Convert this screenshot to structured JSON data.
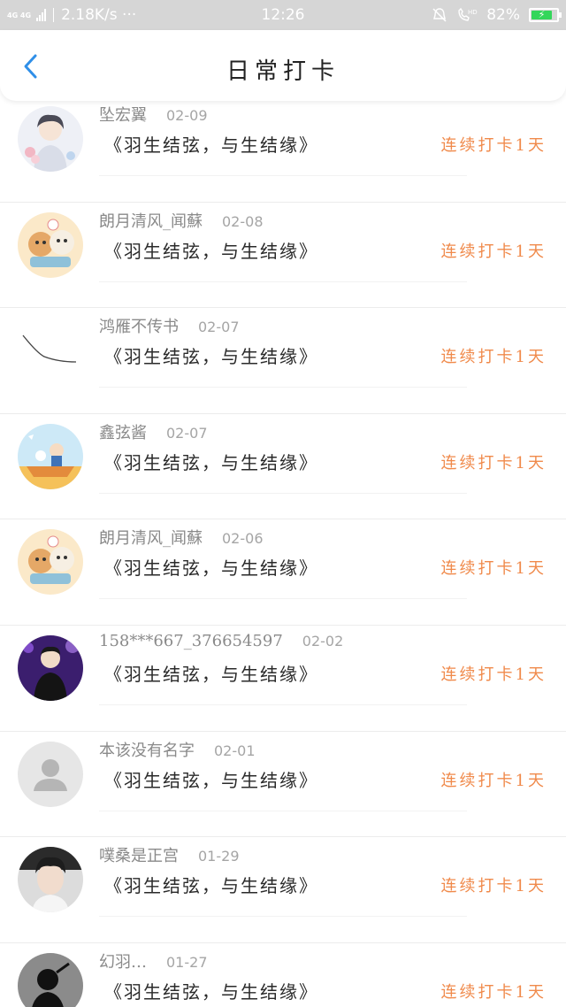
{
  "status_bar": {
    "network": "4G 4G",
    "speed": "2.18K/s ···",
    "time": "12:26",
    "battery": "82%",
    "battery_level": 0.82,
    "accent": "#33d65a"
  },
  "header": {
    "title": "日常打卡",
    "back_icon": "chevron-left-icon",
    "back_color": "#2f8fe8"
  },
  "entries": [
    {
      "name": "坠宏翼",
      "date": "02-09",
      "quote": "《羽生结弦，与生结缘》",
      "streak": "连续打卡1天",
      "avatar": "anime-boy-flowers"
    },
    {
      "name": "朗月清风_闻蘇",
      "date": "02-08",
      "quote": "《羽生结弦，与生结缘》",
      "streak": "连续打卡1天",
      "avatar": "cartoon-dog-sticker"
    },
    {
      "name": "鸿雁不传书",
      "date": "02-07",
      "quote": "《羽生结弦，与生结缘》",
      "streak": "连续打卡1天",
      "avatar": "line-sketch"
    },
    {
      "name": "鑫弦酱",
      "date": "02-07",
      "quote": "《羽生结弦，与生结缘》",
      "streak": "连续打卡1天",
      "avatar": "cartoon-boat"
    },
    {
      "name": "朗月清风_闻蘇",
      "date": "02-06",
      "quote": "《羽生结弦，与生结缘》",
      "streak": "连续打卡1天",
      "avatar": "cartoon-dog-sticker"
    },
    {
      "name": "158***667_376654597",
      "date": "02-02",
      "quote": "《羽生结弦，与生结缘》",
      "streak": "连续打卡1天",
      "avatar": "performer-purple"
    },
    {
      "name": "本该没有名字",
      "date": "02-01",
      "quote": "《羽生结弦，与生结缘》",
      "streak": "连续打卡1天",
      "avatar": "default-user-icon"
    },
    {
      "name": "噗桑是正宫",
      "date": "01-29",
      "quote": "《羽生结弦，与生结缘》",
      "streak": "连续打卡1天",
      "avatar": "portrait-photo"
    },
    {
      "name": "幻羽…",
      "date": "01-27",
      "quote": "《羽生结弦，与生结缘》",
      "streak": "连续打卡1天",
      "avatar": "silhouette"
    }
  ],
  "colors": {
    "streak": "#f08a4b",
    "name": "#8a8a8a",
    "quote": "#2a2a2a"
  }
}
